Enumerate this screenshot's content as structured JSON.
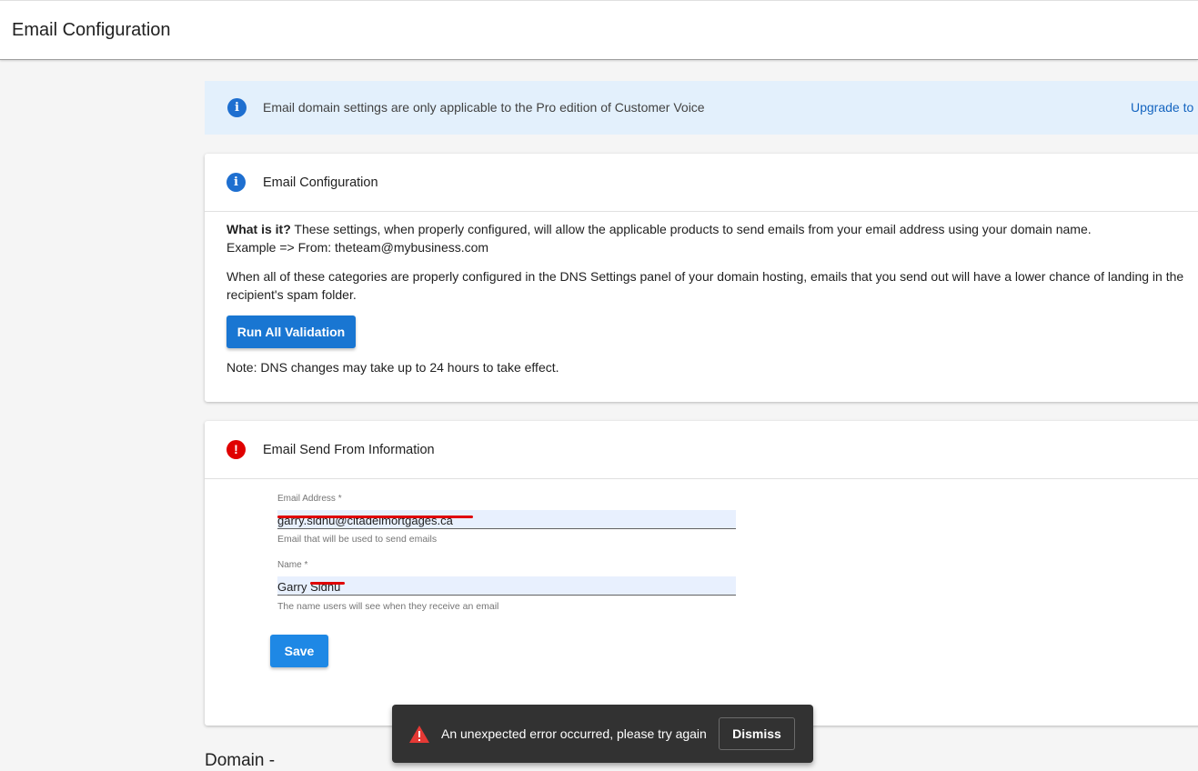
{
  "header": {
    "title": "Email Configuration"
  },
  "banner": {
    "message": "Email domain settings are only applicable to the Pro edition of Customer Voice",
    "upgrade_link": "Upgrade to Pro"
  },
  "config_card": {
    "title": "Email Configuration",
    "what_is_it_label": "What is it?",
    "what_is_it_text": " These settings, when properly configured, will allow the applicable products to send emails from your email address using your domain name.",
    "example_text": "Example => From: theteam@mybusiness.com",
    "categories_text": "When all of these categories are properly configured in the DNS Settings panel of your domain hosting, emails that you send out will have a lower chance of landing in the recipient's spam folder.",
    "run_button": "Run All Validation",
    "note_text": "Note: DNS changes may take up to 24 hours to take effect."
  },
  "send_from_card": {
    "title_prefix": "Email ",
    "title_bold": "Send From",
    "title_suffix": " Information",
    "email_label": "Email Address *",
    "email_value": "garry.sidhu@citadelmortgages.ca",
    "email_help": "Email that will be used to send emails",
    "name_label": "Name *",
    "name_value": "Garry Sidhu",
    "name_help": "The name users will see when they receive an email",
    "save_button": "Save"
  },
  "domain_section": {
    "heading": "Domain -"
  },
  "snackbar": {
    "message": "An unexpected error occurred, please try again",
    "dismiss_button": "Dismiss"
  },
  "colors": {
    "primary": "#1976d2",
    "info": "#1e6fd0",
    "error": "#e00000",
    "banner_bg": "#e3f0fc",
    "snackbar_bg": "#323232"
  },
  "icons": {
    "banner": "info-icon",
    "config": "info-icon",
    "send_from": "error-icon",
    "snackbar": "warning-icon"
  }
}
